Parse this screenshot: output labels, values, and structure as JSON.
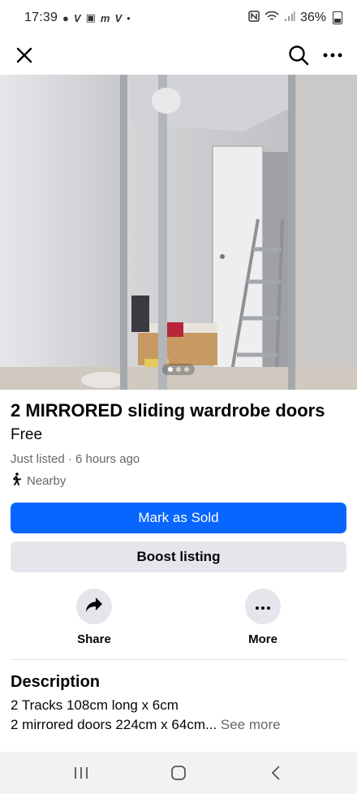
{
  "status_bar": {
    "time": "17:39",
    "left_icons": [
      "chat-bubble-icon",
      "v-app-icon",
      "mail-icon",
      "m-app-icon",
      "v-app-icon",
      "dot-icon"
    ],
    "left_glyphs": [
      "●",
      "V",
      "▣",
      "m",
      "V",
      "•"
    ],
    "right_icons": [
      "nfc-icon",
      "wifi-icon",
      "signal-icon",
      "battery-icon"
    ],
    "battery_percent": "36%"
  },
  "app_bar": {
    "close_icon": "close-icon",
    "search_icon": "search-icon",
    "more_icon": "more-icon"
  },
  "photo": {
    "carousel_count": 3,
    "carousel_active_index": 0
  },
  "listing": {
    "title": "2 MIRRORED sliding wardrobe doors",
    "price": "Free",
    "listed_time": "Just listed · 6 hours ago",
    "location": "Nearby",
    "location_icon": "walking-person-icon"
  },
  "buttons": {
    "mark_sold": "Mark as Sold",
    "boost": "Boost listing"
  },
  "actions": {
    "share_label": "Share",
    "more_label": "More"
  },
  "description": {
    "heading": "Description",
    "line1": "2 Tracks 108cm long x 6cm",
    "line2": "2 mirrored doors 224cm x 64cm...",
    "see_more": "See more"
  },
  "nav_bar": {
    "icons": [
      "recent-apps-icon",
      "home-icon",
      "back-icon"
    ]
  },
  "colors": {
    "accent": "#0866ff",
    "secondary_button": "#e4e6eb",
    "muted_text": "#65676b"
  }
}
